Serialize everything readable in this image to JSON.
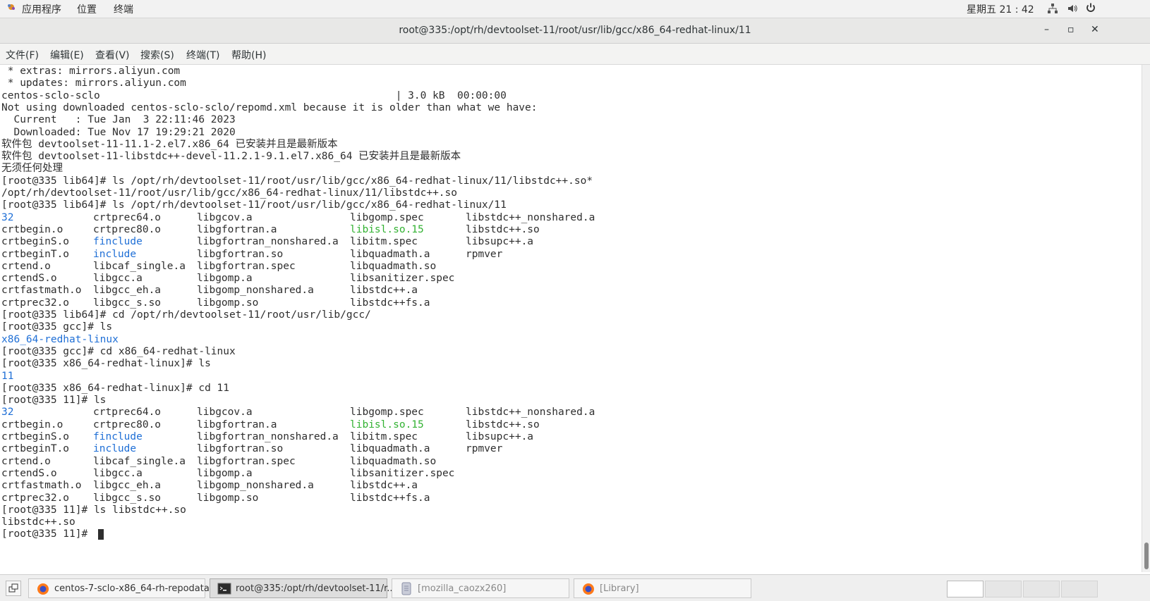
{
  "topbar": {
    "apps": "应用程序",
    "places": "位置",
    "terminal": "终端",
    "clock": "星期五 21 : 42"
  },
  "window": {
    "title": "root@335:/opt/rh/devtoolset-11/root/usr/lib/gcc/x86_64-redhat-linux/11",
    "minimize": "–",
    "maximize": "▫",
    "close": "✕"
  },
  "menu": {
    "file": "文件(F)",
    "edit": "编辑(E)",
    "view": "查看(V)",
    "search": "搜索(S)",
    "terminal": "终端(T)",
    "help": "帮助(H)"
  },
  "terminal": {
    "lines": [
      [
        {
          "t": " * extras: mirrors.aliyun.com"
        }
      ],
      [
        {
          "t": " * updates: mirrors.aliyun.com"
        }
      ],
      [
        {
          "t": "centos-sclo-sclo                                                | 3.0 kB  00:00:00"
        }
      ],
      [
        {
          "t": "Not using downloaded centos-sclo-sclo/repomd.xml because it is older than what we have:"
        }
      ],
      [
        {
          "t": "  Current   : Tue Jan  3 22:11:46 2023"
        }
      ],
      [
        {
          "t": "  Downloaded: Tue Nov 17 19:29:21 2020"
        }
      ],
      [
        {
          "t": "软件包 devtoolset-11-11.1-2.el7.x86_64 已安装并且是最新版本"
        }
      ],
      [
        {
          "t": "软件包 devtoolset-11-libstdc++-devel-11.2.1-9.1.el7.x86_64 已安装并且是最新版本"
        }
      ],
      [
        {
          "t": "无须任何处理"
        }
      ],
      [
        {
          "t": "[root@335 lib64]# ls /opt/rh/devtoolset-11/root/usr/lib/gcc/x86_64-redhat-linux/11/libstdc++.so*"
        }
      ],
      [
        {
          "t": "/opt/rh/devtoolset-11/root/usr/lib/gcc/x86_64-redhat-linux/11/libstdc++.so"
        }
      ],
      [
        {
          "t": "[root@335 lib64]# ls /opt/rh/devtoolset-11/root/usr/lib/gcc/x86_64-redhat-linux/11"
        }
      ],
      [
        {
          "t": "32",
          "c": "blue"
        },
        {
          "t": "crtprec64.o",
          "x": 1
        },
        {
          "t": "libgcov.a",
          "x": 2
        },
        {
          "t": "libgomp.spec",
          "x": 3
        },
        {
          "t": "libstdc++_nonshared.a",
          "x": 4
        }
      ],
      [
        {
          "t": "crtbegin.o"
        },
        {
          "t": "crtprec80.o",
          "x": 1
        },
        {
          "t": "libgfortran.a",
          "x": 2
        },
        {
          "t": "libisl.so.15",
          "x": 3,
          "c": "green"
        },
        {
          "t": "libstdc++.so",
          "x": 4
        }
      ],
      [
        {
          "t": "crtbeginS.o"
        },
        {
          "t": "finclude",
          "x": 1,
          "c": "blue"
        },
        {
          "t": "libgfortran_nonshared.a",
          "x": 2
        },
        {
          "t": "libitm.spec",
          "x": 3
        },
        {
          "t": "libsupc++.a",
          "x": 4
        }
      ],
      [
        {
          "t": "crtbeginT.o"
        },
        {
          "t": "include",
          "x": 1,
          "c": "blue"
        },
        {
          "t": "libgfortran.so",
          "x": 2
        },
        {
          "t": "libquadmath.a",
          "x": 3
        },
        {
          "t": "rpmver",
          "x": 4
        }
      ],
      [
        {
          "t": "crtend.o"
        },
        {
          "t": "libcaf_single.a",
          "x": 1
        },
        {
          "t": "libgfortran.spec",
          "x": 2
        },
        {
          "t": "libquadmath.so",
          "x": 3
        }
      ],
      [
        {
          "t": "crtendS.o"
        },
        {
          "t": "libgcc.a",
          "x": 1
        },
        {
          "t": "libgomp.a",
          "x": 2
        },
        {
          "t": "libsanitizer.spec",
          "x": 3
        }
      ],
      [
        {
          "t": "crtfastmath.o"
        },
        {
          "t": "libgcc_eh.a",
          "x": 1
        },
        {
          "t": "libgomp_nonshared.a",
          "x": 2
        },
        {
          "t": "libstdc++.a",
          "x": 3
        }
      ],
      [
        {
          "t": "crtprec32.o"
        },
        {
          "t": "libgcc_s.so",
          "x": 1
        },
        {
          "t": "libgomp.so",
          "x": 2
        },
        {
          "t": "libstdc++fs.a",
          "x": 3
        }
      ],
      [
        {
          "t": "[root@335 lib64]# cd /opt/rh/devtoolset-11/root/usr/lib/gcc/"
        }
      ],
      [
        {
          "t": "[root@335 gcc]# ls"
        }
      ],
      [
        {
          "t": "x86_64-redhat-linux",
          "c": "blue"
        }
      ],
      [
        {
          "t": "[root@335 gcc]# cd x86_64-redhat-linux"
        }
      ],
      [
        {
          "t": "[root@335 x86_64-redhat-linux]# ls"
        }
      ],
      [
        {
          "t": "11",
          "c": "blue"
        }
      ],
      [
        {
          "t": "[root@335 x86_64-redhat-linux]# cd 11"
        }
      ],
      [
        {
          "t": "[root@335 11]# ls"
        }
      ],
      [
        {
          "t": "32",
          "c": "blue"
        },
        {
          "t": "crtprec64.o",
          "x": 1
        },
        {
          "t": "libgcov.a",
          "x": 2
        },
        {
          "t": "libgomp.spec",
          "x": 3
        },
        {
          "t": "libstdc++_nonshared.a",
          "x": 4
        }
      ],
      [
        {
          "t": "crtbegin.o"
        },
        {
          "t": "crtprec80.o",
          "x": 1
        },
        {
          "t": "libgfortran.a",
          "x": 2
        },
        {
          "t": "libisl.so.15",
          "x": 3,
          "c": "green"
        },
        {
          "t": "libstdc++.so",
          "x": 4
        }
      ],
      [
        {
          "t": "crtbeginS.o"
        },
        {
          "t": "finclude",
          "x": 1,
          "c": "blue"
        },
        {
          "t": "libgfortran_nonshared.a",
          "x": 2
        },
        {
          "t": "libitm.spec",
          "x": 3
        },
        {
          "t": "libsupc++.a",
          "x": 4
        }
      ],
      [
        {
          "t": "crtbeginT.o"
        },
        {
          "t": "include",
          "x": 1,
          "c": "blue"
        },
        {
          "t": "libgfortran.so",
          "x": 2
        },
        {
          "t": "libquadmath.a",
          "x": 3
        },
        {
          "t": "rpmver",
          "x": 4
        }
      ],
      [
        {
          "t": "crtend.o"
        },
        {
          "t": "libcaf_single.a",
          "x": 1
        },
        {
          "t": "libgfortran.spec",
          "x": 2
        },
        {
          "t": "libquadmath.so",
          "x": 3
        }
      ],
      [
        {
          "t": "crtendS.o"
        },
        {
          "t": "libgcc.a",
          "x": 1
        },
        {
          "t": "libgomp.a",
          "x": 2
        },
        {
          "t": "libsanitizer.spec",
          "x": 3
        }
      ],
      [
        {
          "t": "crtfastmath.o"
        },
        {
          "t": "libgcc_eh.a",
          "x": 1
        },
        {
          "t": "libgomp_nonshared.a",
          "x": 2
        },
        {
          "t": "libstdc++.a",
          "x": 3
        }
      ],
      [
        {
          "t": "crtprec32.o"
        },
        {
          "t": "libgcc_s.so",
          "x": 1
        },
        {
          "t": "libgomp.so",
          "x": 2
        },
        {
          "t": "libstdc++fs.a",
          "x": 3
        }
      ],
      [
        {
          "t": "[root@335 11]# ls libstdc++.so"
        }
      ],
      [
        {
          "t": "libstdc++.so"
        }
      ],
      [
        {
          "t": "[root@335 11]# ",
          "cursor": true
        }
      ]
    ]
  },
  "taskbar": {
    "tasks": [
      {
        "label": "centos-7-sclo-x86_64-rh-repodata...",
        "icon": "firefox-icon"
      },
      {
        "label": "root@335:/opt/rh/devtoolset-11/r...",
        "icon": "terminal-icon",
        "active": true
      },
      {
        "label": "[mozilla_caozx260]",
        "icon": "document-icon"
      },
      {
        "label": "[Library]",
        "icon": "firefox-icon"
      }
    ]
  },
  "colors": {
    "blue": "#1f6fd6",
    "green": "#33b233"
  }
}
